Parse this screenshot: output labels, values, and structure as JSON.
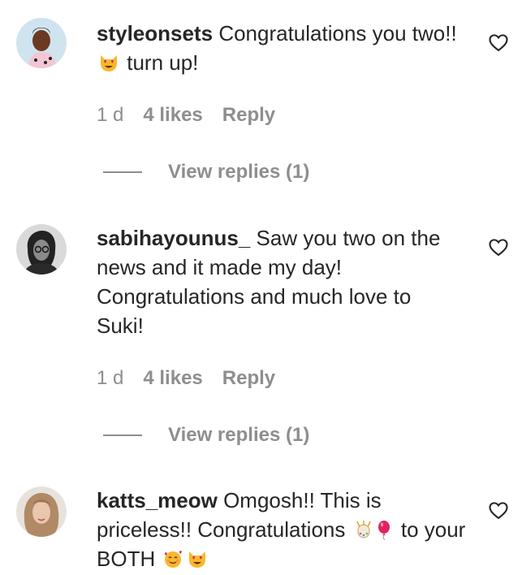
{
  "comments": [
    {
      "username": "styleonsets",
      "text_before_emoji": "Congratulations you two!!",
      "text_after_emoji": "turn up!",
      "emoji_icon": "heart-eyes-cat-icon",
      "time": "1 d",
      "likes": "4 likes",
      "reply_label": "Reply",
      "view_replies_label": "View replies (1)"
    },
    {
      "username": "sabihayounus_",
      "text": "Saw you two on the news and it made my day! Congratulations and much love to Suki!",
      "time": "1 d",
      "likes": "4 likes",
      "reply_label": "Reply",
      "view_replies_label": "View replies (1)"
    },
    {
      "username": "katts_meow",
      "text_before_emoji": "Omgosh!! This is priceless!! Congratulations",
      "text_middle": "to your BOTH",
      "emoji_icons": [
        "confetti-ball-icon",
        "balloon-icon",
        "smiling-face-with-hearts-icon",
        "heart-eyes-cat-icon"
      ]
    }
  ],
  "colors": {
    "text": "#262626",
    "muted": "#8e8e8e",
    "background": "#ffffff"
  }
}
